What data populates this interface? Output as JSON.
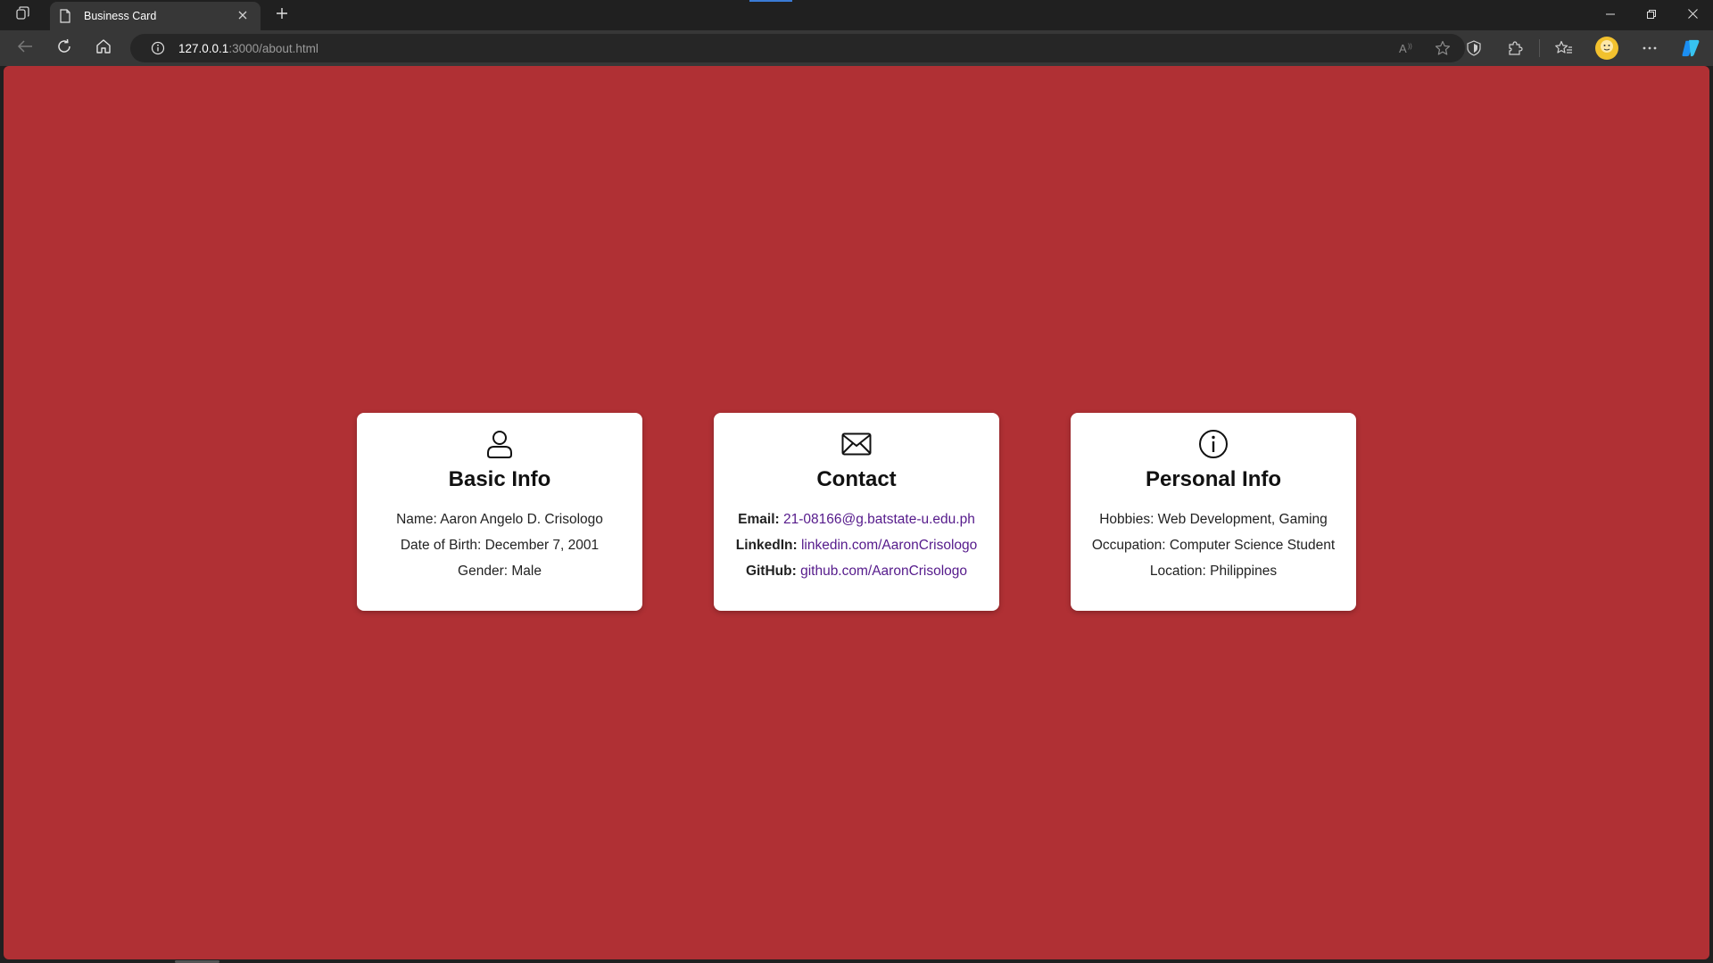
{
  "browser": {
    "tab": {
      "title": "Business Card"
    },
    "address": {
      "host": "127.0.0.1",
      "rest": ":3000/about.html"
    }
  },
  "colors": {
    "page_background": "#b03034",
    "card_background": "#ffffff",
    "link": "#551a8b",
    "chrome_dark": "#202020",
    "chrome_toolbar": "#373737"
  },
  "cards": {
    "basic": {
      "icon": "user-icon",
      "title": "Basic Info",
      "name": "Name: Aaron Angelo D. Crisologo",
      "dob": "Date of Birth: December 7, 2001",
      "gender": "Gender: Male"
    },
    "contact": {
      "icon": "envelope-icon",
      "title": "Contact",
      "email_label": "Email:",
      "email_value": "21-08166@g.batstate-u.edu.ph",
      "linkedin_label": "LinkedIn:",
      "linkedin_value": "linkedin.com/AaronCrisologo",
      "github_label": "GitHub:",
      "github_value": "github.com/AaronCrisologo"
    },
    "personal": {
      "icon": "info-icon",
      "title": "Personal Info",
      "hobbies": "Hobbies: Web Development, Gaming",
      "occupation": "Occupation: Computer Science Student",
      "location": "Location: Philippines"
    }
  }
}
